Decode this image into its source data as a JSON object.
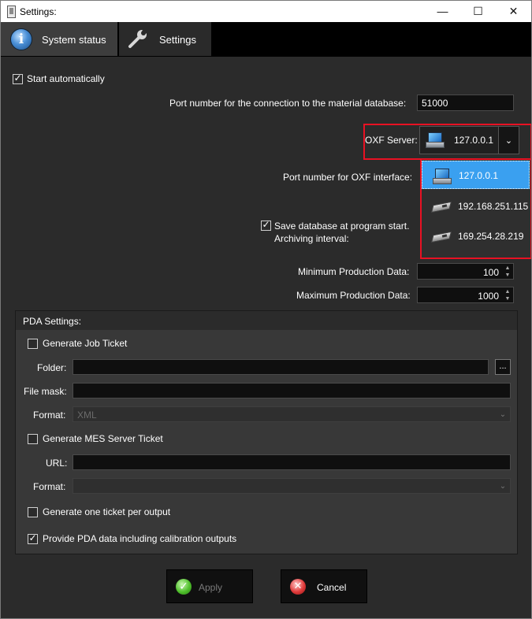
{
  "window": {
    "title": "Settings:",
    "minimize": "—",
    "maximize": "☐",
    "close": "✕"
  },
  "tabs": [
    {
      "label": "System status",
      "icon": "info-icon"
    },
    {
      "label": "Settings",
      "icon": "wrench-icon"
    }
  ],
  "general": {
    "start_automatically": {
      "label": "Start automatically",
      "checked": true
    },
    "material_db_port": {
      "label": "Port number for the connection to the material database:",
      "value": "51000"
    },
    "oxf_server": {
      "label": "OXF Server:",
      "selected": "127.0.0.1",
      "icon": "monitor-icon",
      "options": [
        {
          "label": "127.0.0.1",
          "icon": "monitor-icon",
          "selected": true
        },
        {
          "label": "192.168.251.115",
          "icon": "network-adapter-icon",
          "selected": false
        },
        {
          "label": "169.254.28.219",
          "icon": "network-adapter-icon",
          "selected": false
        }
      ]
    },
    "oxf_port": {
      "label": "Port number for OXF interface:"
    },
    "save_db": {
      "label": "Save database at program start.",
      "checked": true
    },
    "archiving_interval": {
      "label": "Archiving interval:"
    },
    "min_production": {
      "label": "Minimum Production Data:",
      "value": "100"
    },
    "max_production": {
      "label": "Maximum Production Data:",
      "value": "1000"
    }
  },
  "pda": {
    "title": "PDA Settings:",
    "generate_job_ticket": {
      "label": "Generate Job Ticket",
      "checked": false
    },
    "folder": {
      "label": "Folder:",
      "value": "",
      "browse": "..."
    },
    "file_mask": {
      "label": "File mask:",
      "value": ""
    },
    "format1": {
      "label": "Format:",
      "value": "XML"
    },
    "generate_mes": {
      "label": "Generate MES Server Ticket",
      "checked": false
    },
    "url": {
      "label": "URL:",
      "value": ""
    },
    "format2": {
      "label": "Format:",
      "value": ""
    },
    "one_per_output": {
      "label": "Generate one ticket per output",
      "checked": false
    },
    "calibration": {
      "label": "Provide PDA data including calibration outputs",
      "checked": true
    }
  },
  "buttons": {
    "apply": "Apply",
    "cancel": "Cancel"
  },
  "colors": {
    "highlight": "#e81123",
    "selection": "#3aa0f0",
    "background": "#2b2b2b"
  }
}
